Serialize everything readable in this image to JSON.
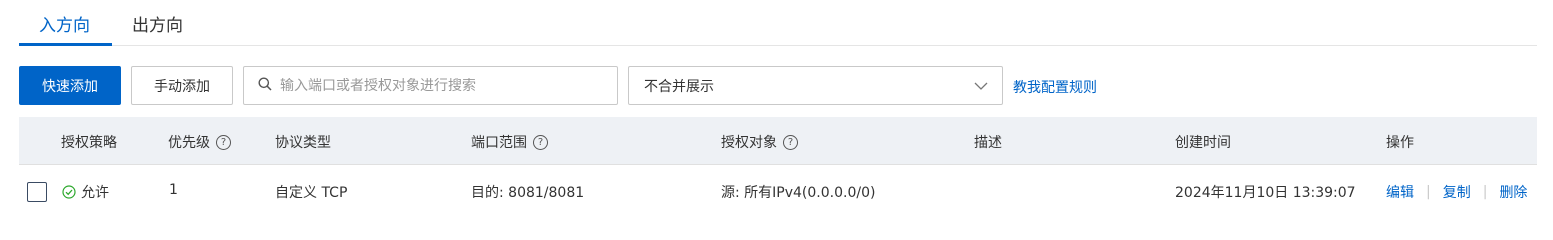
{
  "tabs": [
    {
      "label": "入方向",
      "active": true
    },
    {
      "label": "出方向",
      "active": false
    }
  ],
  "toolbar": {
    "quick_add_label": "快速添加",
    "manual_add_label": "手动添加"
  },
  "search": {
    "placeholder": "输入端口或者授权对象进行搜索",
    "value": ""
  },
  "merge_select": {
    "selected": "不合并展示"
  },
  "help_link": "教我配置规则",
  "table": {
    "columns": [
      {
        "label": "授权策略",
        "help": false
      },
      {
        "label": "优先级",
        "help": true
      },
      {
        "label": "协议类型",
        "help": false
      },
      {
        "label": "端口范围",
        "help": true
      },
      {
        "label": "授权对象",
        "help": true
      },
      {
        "label": "描述",
        "help": false
      },
      {
        "label": "创建时间",
        "help": false
      },
      {
        "label": "操作",
        "help": false
      }
    ],
    "rows": [
      {
        "checked": false,
        "policy": "允许",
        "priority": "1",
        "protocol": "自定义 TCP",
        "port_range": "目的: 8081/8081",
        "auth_object": "源: 所有IPv4(0.0.0.0/0)",
        "description": "",
        "created_at": "2024年11月10日 13:39:07",
        "actions": {
          "edit": "编辑",
          "copy": "复制",
          "delete": "删除"
        }
      }
    ]
  },
  "help_icon_glyph": "?",
  "colors": {
    "accent": "#0064c8",
    "header_bg": "#eef1f5",
    "allow_green": "#2ca82c"
  }
}
